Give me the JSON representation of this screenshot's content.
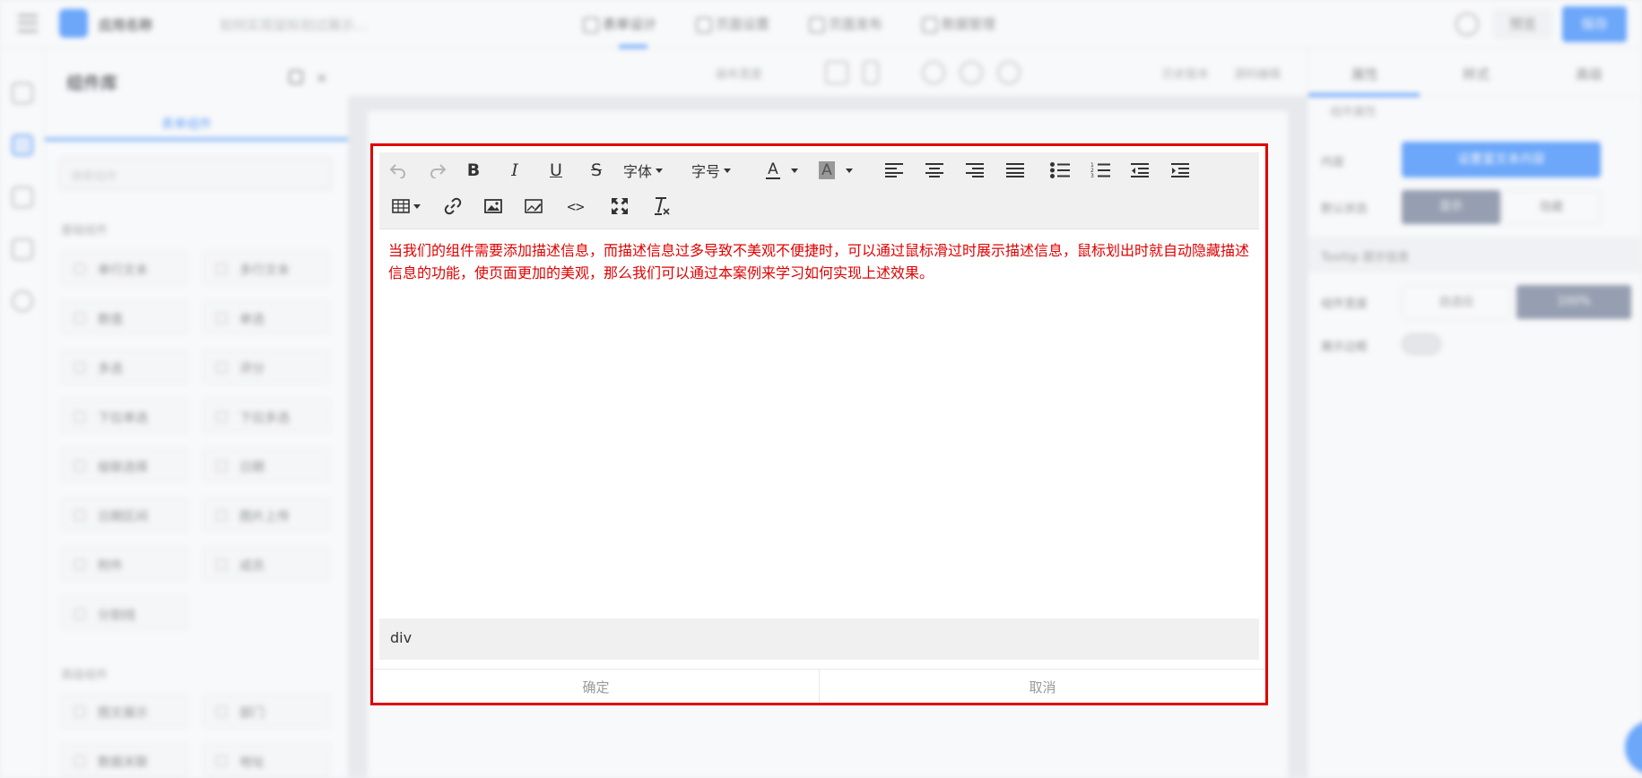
{
  "app": {
    "name": "应用名称",
    "page_name": "如何实现鼠标划过展示…",
    "tabs": [
      {
        "label": "表单设计",
        "active": true
      },
      {
        "label": "页面设置",
        "active": false
      },
      {
        "label": "页面发布",
        "active": false
      },
      {
        "label": "数据管理",
        "active": false
      }
    ],
    "preview_label": "预览",
    "publish_label": "保存"
  },
  "left_panel": {
    "title": "组件库",
    "tab_label": "表单组件",
    "search_placeholder": "搜索组件",
    "group_basic": "基础组件",
    "group_advanced": "高级组件",
    "components": [
      "单行文本",
      "多行文本",
      "数值",
      "单选",
      "多选",
      "评分",
      "下拉单选",
      "下拉多选",
      "级联选择",
      "日期",
      "日期区间",
      "图片上传",
      "附件",
      "成员",
      "分割线"
    ],
    "advanced_components": [
      "图文展示",
      "部门",
      "数据关联",
      "地址"
    ]
  },
  "canvas_toolbar": {
    "device_label": "画布宽度",
    "history_label": "历史版本",
    "code_label": "源码编辑"
  },
  "right_panel": {
    "tabs": [
      "属性",
      "样式",
      "高级"
    ],
    "crumb": "组件属性",
    "field_label": "内容",
    "button_label": "设置富文本内容",
    "visibility_label": "默认状态",
    "seg_on": "显示",
    "seg_off": "隐藏",
    "section_title": "Tooltip 提示信息",
    "width_label": "组件宽度",
    "width_seg_a": "自适应",
    "width_seg_b": "100%",
    "toggle_label": "展示边框"
  },
  "editor": {
    "toolbar": {
      "font_family_label": "字体",
      "font_size_label": "字号",
      "font_color_glyph": "A",
      "bg_color_glyph": "A",
      "bold_glyph": "B",
      "italic_glyph": "I",
      "underline_glyph": "U",
      "strike_glyph": "S",
      "code_glyph": "<>"
    },
    "content": "当我们的组件需要添加描述信息，而描述信息过多导致不美观不便捷时，可以通过鼠标滑过时展示描述信息，鼠标划出时就自动隐藏描述信息的功能，使页面更加的美观，那么我们可以通过本案例来学习如何实现上述效果。",
    "content_color": "#e00000",
    "status_path": "div",
    "confirm_label": "确定",
    "cancel_label": "取消"
  },
  "colors": {
    "accent": "#1677ff",
    "highlight_border": "#e10000"
  }
}
